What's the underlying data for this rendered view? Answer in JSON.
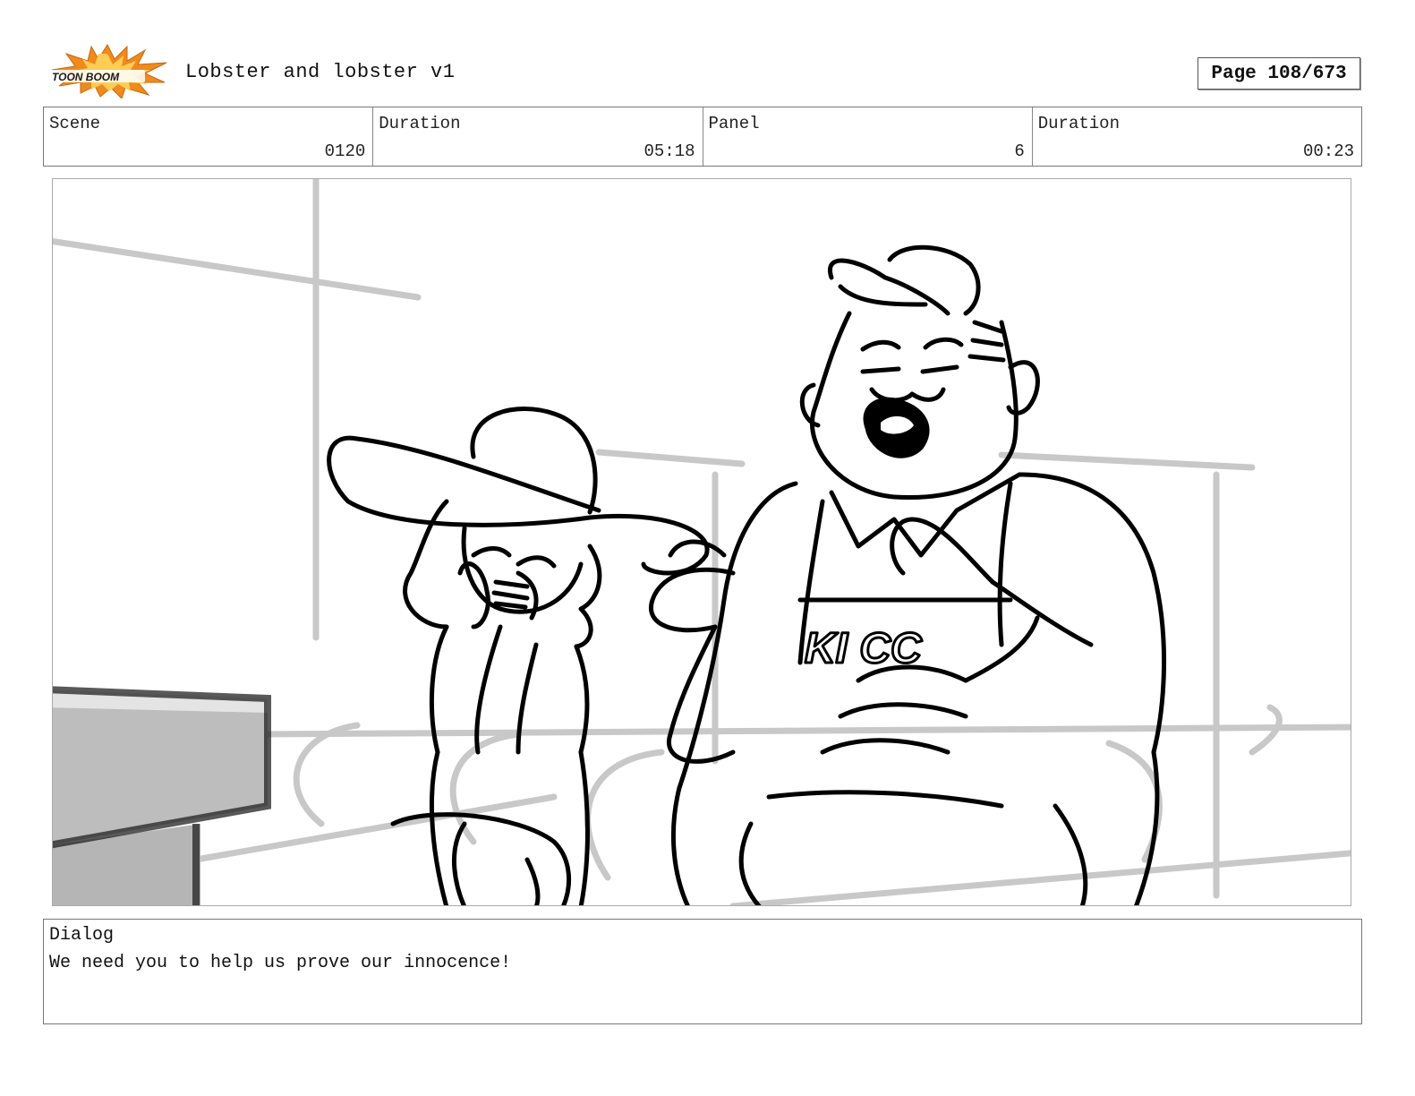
{
  "header": {
    "logo_text": "TOON BOOM",
    "title": "Lobster and lobster v1",
    "page": "Page 108/673"
  },
  "info": {
    "scene_label": "Scene",
    "scene_value": "0120",
    "scene_duration_label": "Duration",
    "scene_duration_value": "05:18",
    "panel_label": "Panel",
    "panel_value": "6",
    "panel_duration_label": "Duration",
    "panel_duration_value": "00:23"
  },
  "panel": {
    "apron_text": "KI CC"
  },
  "dialog": {
    "label": "Dialog",
    "text": "We need you to help us prove our innocence!"
  },
  "colors": {
    "logo_orange": "#f08a1c",
    "logo_dark": "#1a1a1a",
    "sketch_line": "#000000",
    "guide_line": "#c8c8c8",
    "foreground_block": "#bdbdbd"
  }
}
